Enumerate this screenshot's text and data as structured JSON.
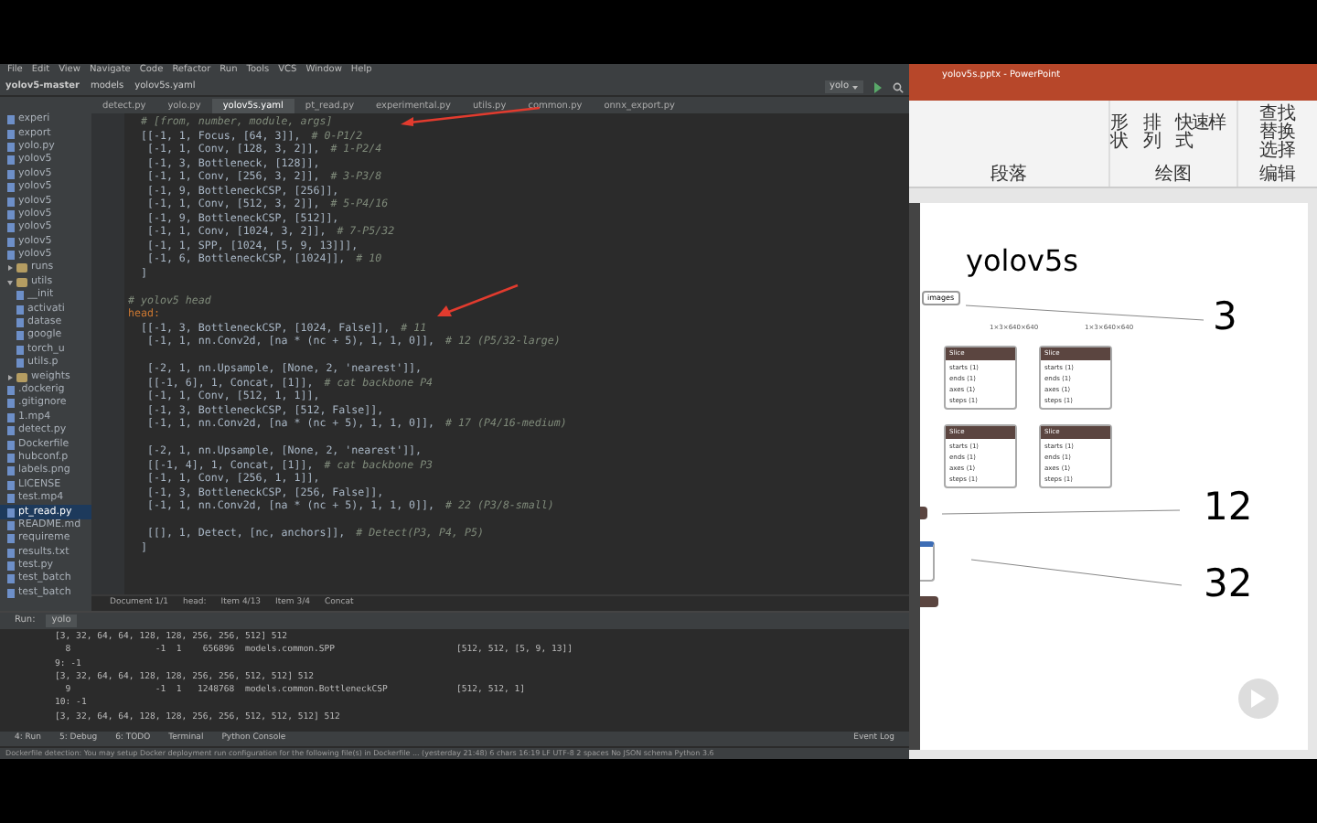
{
  "ide": {
    "menu": [
      "File",
      "Edit",
      "View",
      "Navigate",
      "Code",
      "Refactor",
      "Run",
      "Tools",
      "VCS",
      "Window",
      "Help"
    ],
    "breadcrumb": [
      "yolov5-master",
      "models",
      "yolov5s.yaml"
    ],
    "run_config": "yolo",
    "tabs": [
      {
        "label": "detect.py",
        "selected": false
      },
      {
        "label": "yolo.py",
        "selected": false
      },
      {
        "label": "yolov5s.yaml",
        "selected": true
      },
      {
        "label": "pt_read.py",
        "selected": false
      },
      {
        "label": "experimental.py",
        "selected": false
      },
      {
        "label": "utils.py",
        "selected": false
      },
      {
        "label": "common.py",
        "selected": false
      },
      {
        "label": "onnx_export.py",
        "selected": false
      }
    ],
    "project_tree": [
      {
        "label": "experi",
        "kind": "file",
        "selected": false
      },
      {
        "label": "export",
        "kind": "file",
        "selected": false
      },
      {
        "label": "yolo.py",
        "kind": "file",
        "selected": false
      },
      {
        "label": "yolov5",
        "kind": "file",
        "selected": false
      },
      {
        "label": "yolov5",
        "kind": "file",
        "selected": false
      },
      {
        "label": "yolov5",
        "kind": "file",
        "selected": false
      },
      {
        "label": "yolov5",
        "kind": "file",
        "selected": false
      },
      {
        "label": "yolov5",
        "kind": "file",
        "selected": false
      },
      {
        "label": "yolov5",
        "kind": "file",
        "selected": false
      },
      {
        "label": "yolov5",
        "kind": "file",
        "selected": false
      },
      {
        "label": "yolov5",
        "kind": "file",
        "selected": false
      },
      {
        "label": "runs",
        "kind": "folder",
        "selected": false,
        "expanded": false
      },
      {
        "label": "utils",
        "kind": "folder",
        "selected": false,
        "expanded": true,
        "children": [
          {
            "label": "__init",
            "kind": "file",
            "selected": false
          },
          {
            "label": "activati",
            "kind": "file",
            "selected": false
          },
          {
            "label": "datase",
            "kind": "file",
            "selected": false
          },
          {
            "label": "google",
            "kind": "file",
            "selected": false
          },
          {
            "label": "torch_u",
            "kind": "file",
            "selected": false
          },
          {
            "label": "utils.p",
            "kind": "file",
            "selected": false
          }
        ]
      },
      {
        "label": "weights",
        "kind": "folder",
        "selected": false,
        "expanded": false
      },
      {
        "label": ".dockerig",
        "kind": "file",
        "selected": false
      },
      {
        "label": ".gitignore",
        "kind": "file",
        "selected": false
      },
      {
        "label": "1.mp4",
        "kind": "file",
        "selected": false
      },
      {
        "label": "detect.py",
        "kind": "file",
        "selected": false
      },
      {
        "label": "Dockerfile",
        "kind": "file",
        "selected": false
      },
      {
        "label": "hubconf.p",
        "kind": "file",
        "selected": false
      },
      {
        "label": "labels.png",
        "kind": "file",
        "selected": false
      },
      {
        "label": "LICENSE",
        "kind": "file",
        "selected": false
      },
      {
        "label": "test.mp4",
        "kind": "file",
        "selected": false
      },
      {
        "label": "pt_read.py",
        "kind": "file",
        "selected": true
      },
      {
        "label": "README.md",
        "kind": "file",
        "selected": false
      },
      {
        "label": "requireme",
        "kind": "file",
        "selected": false
      },
      {
        "label": "results.txt",
        "kind": "file",
        "selected": false
      },
      {
        "label": "test.py",
        "kind": "file",
        "selected": false
      },
      {
        "label": "test_batch",
        "kind": "file",
        "selected": false
      },
      {
        "label": "test_batch",
        "kind": "file",
        "selected": false
      }
    ],
    "code_lines": [
      {
        "kind": "comment",
        "text": "  # [from, number, module, args]"
      },
      {
        "kind": "code",
        "text": "  [[-1, 1, Focus, [64, 3]],",
        "comment": "# 0-P1/2"
      },
      {
        "kind": "code",
        "text": "   [-1, 1, Conv, [128, 3, 2]],",
        "comment": "# 1-P2/4"
      },
      {
        "kind": "code",
        "text": "   [-1, 3, Bottleneck, [128]],"
      },
      {
        "kind": "code",
        "text": "   [-1, 1, Conv, [256, 3, 2]],",
        "comment": "# 3-P3/8"
      },
      {
        "kind": "code",
        "text": "   [-1, 9, BottleneckCSP, [256]],"
      },
      {
        "kind": "code",
        "text": "   [-1, 1, Conv, [512, 3, 2]],",
        "comment": "# 5-P4/16"
      },
      {
        "kind": "code",
        "text": "   [-1, 9, BottleneckCSP, [512]],"
      },
      {
        "kind": "code",
        "text": "   [-1, 1, Conv, [1024, 3, 2]],",
        "comment": "# 7-P5/32"
      },
      {
        "kind": "code",
        "text": "   [-1, 1, SPP, [1024, [5, 9, 13]]],"
      },
      {
        "kind": "code",
        "text": "   [-1, 6, BottleneckCSP, [1024]],",
        "comment": "# 10"
      },
      {
        "kind": "code",
        "text": "  ]"
      },
      {
        "kind": "blank"
      },
      {
        "kind": "comment",
        "text": "# yolov5 head"
      },
      {
        "kind": "key",
        "text": "head:"
      },
      {
        "kind": "code",
        "text": "  [[-1, 3, BottleneckCSP, [1024, False]],",
        "comment": "# 11"
      },
      {
        "kind": "code",
        "text": "   [-1, 1, nn.Conv2d, [na * (nc + 5), 1, 1, 0]],",
        "comment": "# 12 (P5/32-large)"
      },
      {
        "kind": "blank"
      },
      {
        "kind": "code",
        "text": "   [-2, 1, nn.Upsample, [None, 2, 'nearest']],"
      },
      {
        "kind": "code",
        "text": "   [[-1, 6], 1, Concat, [1]],",
        "comment": "# cat backbone P4"
      },
      {
        "kind": "code",
        "text": "   [-1, 1, Conv, [512, 1, 1]],"
      },
      {
        "kind": "code",
        "text": "   [-1, 3, BottleneckCSP, [512, False]],"
      },
      {
        "kind": "code",
        "text": "   [-1, 1, nn.Conv2d, [na * (nc + 5), 1, 1, 0]],",
        "comment": "# 17 (P4/16-medium)"
      },
      {
        "kind": "blank"
      },
      {
        "kind": "code",
        "text": "   [-2, 1, nn.Upsample, [None, 2, 'nearest']],"
      },
      {
        "kind": "code",
        "text": "   [[-1, 4], 1, Concat, [1]],",
        "comment": "# cat backbone P3"
      },
      {
        "kind": "code",
        "text": "   [-1, 1, Conv, [256, 1, 1]],"
      },
      {
        "kind": "code",
        "text": "   [-1, 3, BottleneckCSP, [256, False]],"
      },
      {
        "kind": "code",
        "text": "   [-1, 1, nn.Conv2d, [na * (nc + 5), 1, 1, 0]],",
        "comment": "# 22 (P3/8-small)"
      },
      {
        "kind": "blank"
      },
      {
        "kind": "code",
        "text": "   [[], 1, Detect, [nc, anchors]],",
        "comment": "# Detect(P3, P4, P5)"
      },
      {
        "kind": "code",
        "text": "  ]"
      }
    ],
    "editor_breadcrumb": [
      "Document 1/1",
      "head:",
      "Item 4/13",
      "Item 3/4",
      "Concat"
    ],
    "run_panel": {
      "title": "Run:",
      "tab": "yolo",
      "lines": [
        "[3, 32, 64, 64, 128, 128, 256, 256, 512] 512",
        "  8                -1  1    656896  models.common.SPP                       [512, 512, [5, 9, 13]]",
        "9: -1",
        "[3, 32, 64, 64, 128, 128, 256, 256, 512, 512] 512",
        "  9                -1  1   1248768  models.common.BottleneckCSP             [512, 512, 1]",
        "10: -1",
        "[3, 32, 64, 64, 128, 128, 256, 256, 512, 512, 512] 512"
      ]
    },
    "tool_windows": [
      "4: Run",
      "5: Debug",
      "6: TODO",
      "Terminal",
      "Python Console"
    ],
    "event_log": "Event Log",
    "status_bar": "Dockerfile detection: You may setup Docker deployment run configuration for the following file(s) in Dockerfile ... (yesterday 21:48)   6 chars   16:19   LF   UTF-8   2 spaces   No JSON schema   Python 3.6"
  },
  "ppt": {
    "title": "yolov5s.pptx - PowerPoint",
    "ribbon_buttons": [
      "形状",
      "排列",
      "快速样式"
    ],
    "edit_buttons": [
      "查找",
      "替换",
      "选择"
    ],
    "groups": [
      "段落",
      "绘图",
      "编辑"
    ],
    "slide": {
      "title": "yolov5s",
      "input_node": "images",
      "edge_labels": [
        "1×3×640×640",
        "1×3×640×640"
      ],
      "slice_nodes": [
        {
          "title": "Slice",
          "fields": [
            "starts ⟨1⟩",
            "ends ⟨1⟩",
            "axes ⟨1⟩",
            "steps ⟨1⟩"
          ]
        },
        {
          "title": "Slice",
          "fields": [
            "starts ⟨1⟩",
            "ends ⟨1⟩",
            "axes ⟨1⟩",
            "steps ⟨1⟩"
          ]
        },
        {
          "title": "Slice",
          "fields": [
            "starts ⟨1⟩",
            "ends ⟨1⟩",
            "axes ⟨1⟩",
            "steps ⟨1⟩"
          ]
        },
        {
          "title": "Slice",
          "fields": [
            "starts ⟨1⟩",
            "ends ⟨1⟩",
            "axes ⟨1⟩",
            "steps ⟨1⟩"
          ]
        }
      ],
      "numbers": [
        "3",
        "12",
        "32"
      ]
    }
  }
}
